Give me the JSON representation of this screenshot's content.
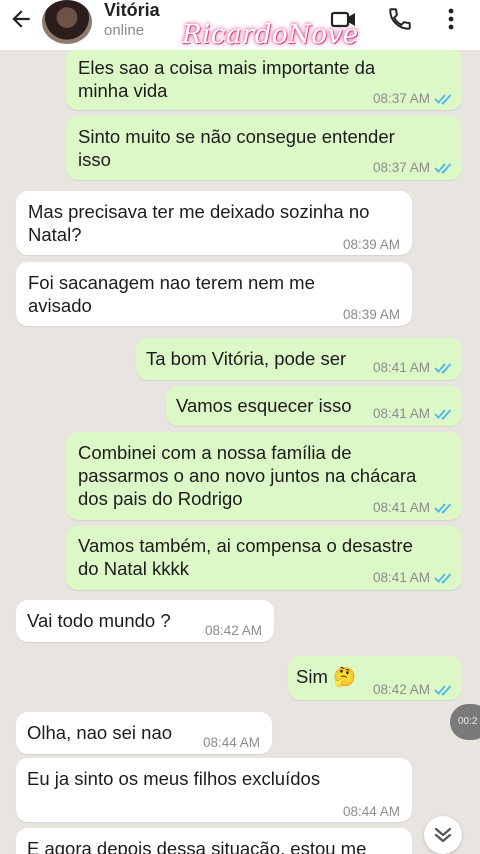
{
  "header": {
    "contact_name": "Vitória",
    "status": "online",
    "watermark": "RicardoNove"
  },
  "messages": [
    {
      "dir": "out",
      "lines": [
        "Eles sao a coisa mais importante da",
        "minha vida"
      ],
      "time": "08:37 AM",
      "read": true
    },
    {
      "dir": "out",
      "lines": [
        "Sinto muito se não consegue entender",
        "isso"
      ],
      "time": "08:37 AM",
      "read": true
    },
    {
      "dir": "in",
      "lines": [
        "Mas precisava ter me deixado sozinha no",
        "Natal?"
      ],
      "time": "08:39 AM"
    },
    {
      "dir": "in",
      "lines": [
        "Foi sacanagem nao terem nem me",
        "avisado"
      ],
      "time": "08:39 AM"
    },
    {
      "dir": "out",
      "lines": [
        "Ta bom Vitória, pode ser"
      ],
      "time": "08:41 AM",
      "read": true
    },
    {
      "dir": "out",
      "lines": [
        "Vamos esquecer isso"
      ],
      "time": "08:41 AM",
      "read": true
    },
    {
      "dir": "out",
      "lines": [
        "Combinei com a nossa família de",
        "passarmos o ano novo juntos na chácara",
        "dos pais do Rodrigo"
      ],
      "time": "08:41 AM",
      "read": true
    },
    {
      "dir": "out",
      "lines": [
        "Vamos também, ai compensa o desastre",
        "do Natal kkkk"
      ],
      "time": "08:41 AM",
      "read": true
    },
    {
      "dir": "in",
      "lines": [
        "Vai todo mundo ?"
      ],
      "time": "08:42 AM"
    },
    {
      "dir": "out",
      "lines": [
        "Sim 🤔"
      ],
      "time": "08:42 AM",
      "read": true
    },
    {
      "dir": "in",
      "lines": [
        "Olha, nao sei nao"
      ],
      "time": "08:44 AM"
    },
    {
      "dir": "in",
      "lines": [
        "Eu ja sinto os meus filhos excluídos"
      ],
      "time": "08:44 AM"
    },
    {
      "dir": "in",
      "lines": [
        "E agora depois dessa situação, estou me"
      ],
      "time": ""
    }
  ],
  "side_pill": "00:2",
  "icons": {
    "back": "arrow-left-icon",
    "video": "video-camera-icon",
    "call": "phone-icon",
    "menu": "more-vertical-icon",
    "scroll": "double-chevron-down-icon",
    "read": "double-check-icon"
  },
  "colors": {
    "outgoing_bubble": "#dcf8c6",
    "incoming_bubble": "#ffffff",
    "chat_background": "#e8e4df",
    "read_ticks": "#4fb6ec",
    "watermark_glow": "#e05c9a"
  }
}
